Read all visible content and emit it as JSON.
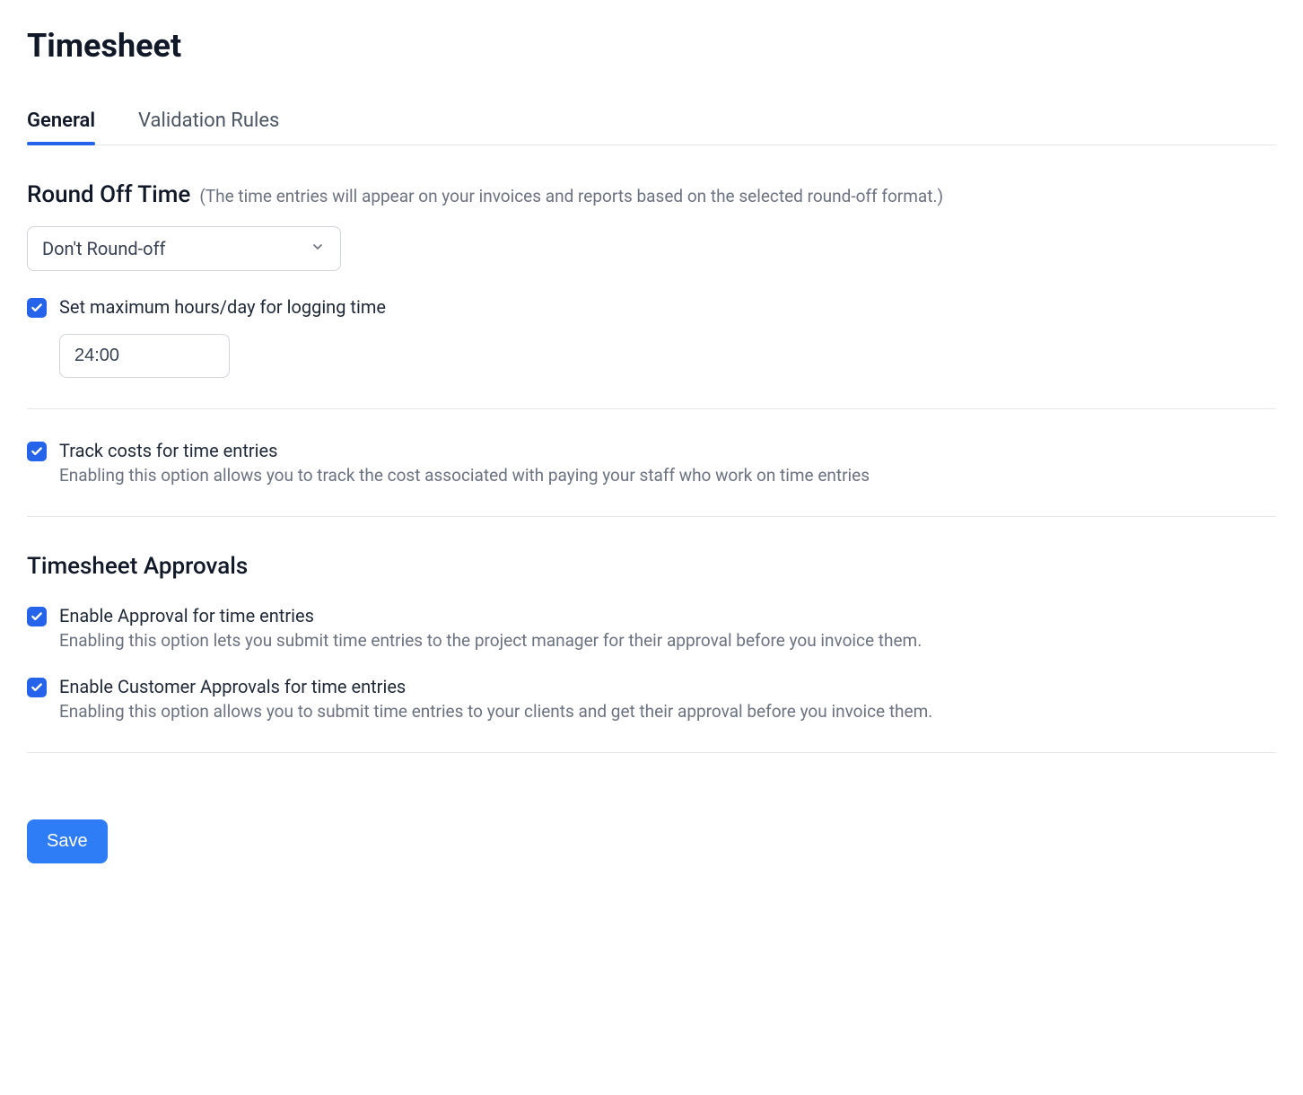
{
  "page": {
    "title": "Timesheet"
  },
  "tabs": [
    {
      "label": "General",
      "active": true
    },
    {
      "label": "Validation Rules",
      "active": false
    }
  ],
  "round_off": {
    "title": "Round Off Time",
    "hint": "(The time entries will appear on your invoices and reports based on the selected round-off format.)",
    "selected": "Don't Round-off"
  },
  "max_hours": {
    "checked": true,
    "label": "Set maximum hours/day for logging time",
    "value": "24:00"
  },
  "track_costs": {
    "checked": true,
    "label": "Track costs for time entries",
    "desc": "Enabling this option allows you to track the cost associated with paying your staff who work on time entries"
  },
  "approvals": {
    "title": "Timesheet Approvals",
    "enable_approval": {
      "checked": true,
      "label": "Enable Approval for time entries",
      "desc": "Enabling this option lets you submit time entries to the project manager for their approval before you invoice them."
    },
    "customer_approval": {
      "checked": true,
      "label": "Enable Customer Approvals for time entries",
      "desc": "Enabling this option allows you to submit time entries to your clients and get their approval before you invoice them."
    }
  },
  "actions": {
    "save": "Save"
  }
}
